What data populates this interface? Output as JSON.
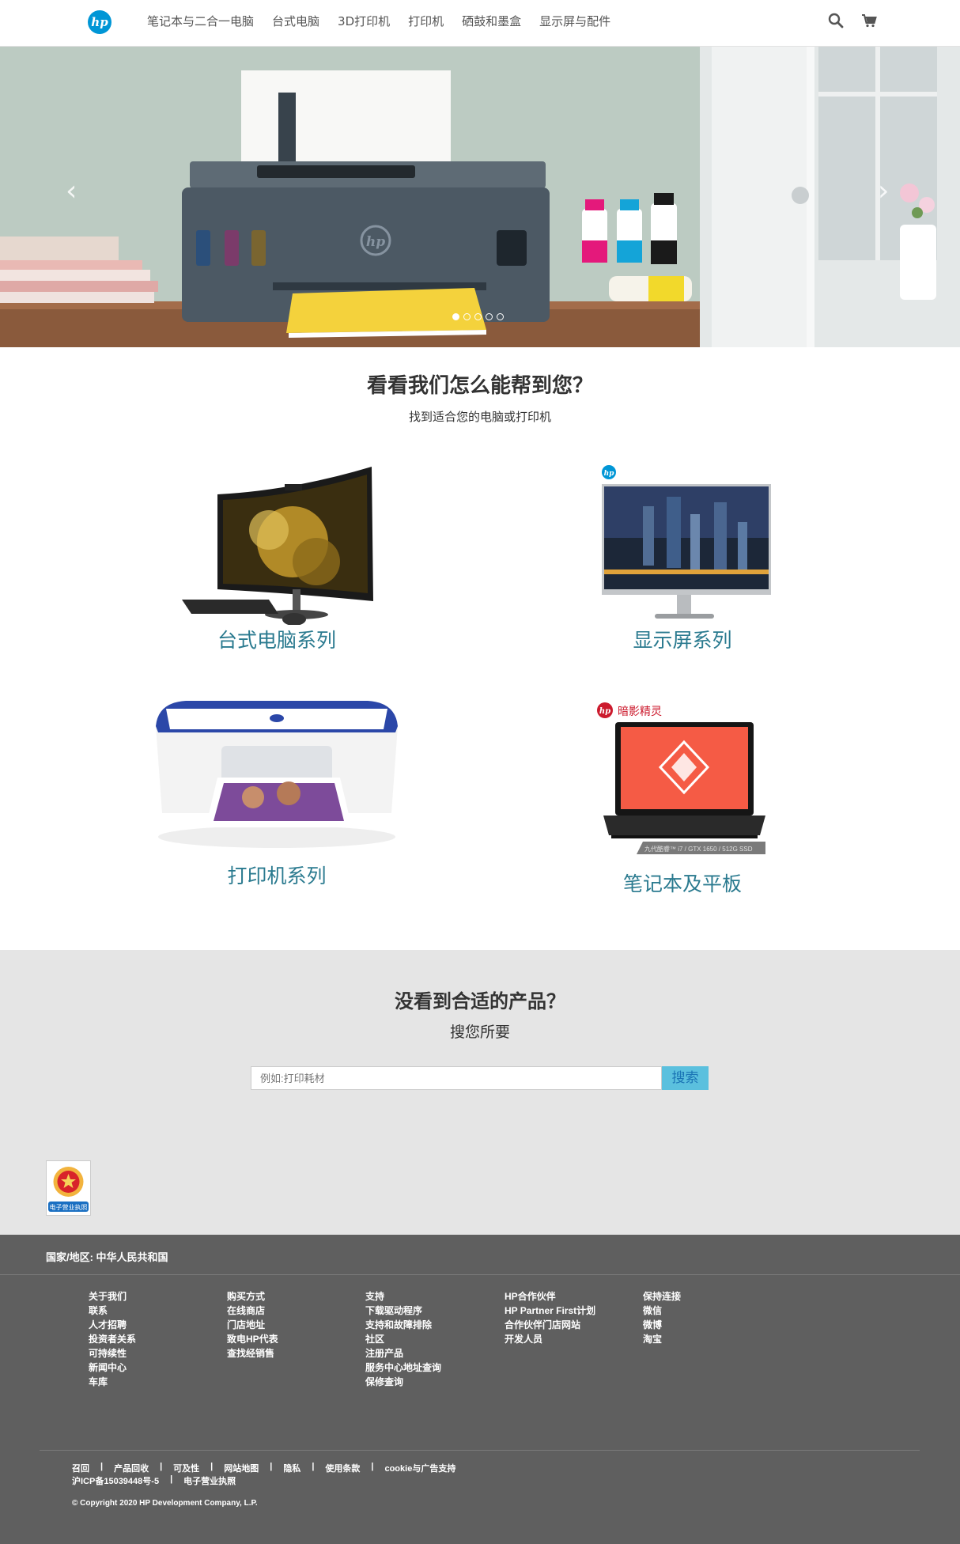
{
  "header": {
    "logo_text": "hp",
    "nav": [
      "笔记本与二合一电脑",
      "台式电脑",
      "3D打印机",
      "打印机",
      "硒鼓和墨盒",
      "显示屏与配件"
    ],
    "icons": [
      "search-icon",
      "cart-icon"
    ]
  },
  "carousel": {
    "slide_count": 5,
    "active_slide": 1,
    "image_text": "hp"
  },
  "help": {
    "title": "看看我们怎么能帮到您？",
    "subtitle": "找到适合您的电脑或打印机",
    "categories": [
      {
        "label": "台式电脑系列",
        "image": "desktop-computer"
      },
      {
        "label": "显示屏系列",
        "image": "monitor",
        "badge": "hp"
      },
      {
        "label": "打印机系列",
        "image": "printer"
      },
      {
        "label": "笔记本及平板",
        "image": "laptop",
        "badge": "暗影精灵",
        "caption": "九代酷睿™ i7 / GTX 1650 / 512G SSD"
      }
    ]
  },
  "search": {
    "title": "没看到合适的产品？",
    "subtitle": "搜您所要",
    "placeholder": "例如:打印耗材",
    "button": "搜索",
    "license_label": "电子营业执照"
  },
  "footer": {
    "region": "国家/地区: 中华人民共和国",
    "columns": [
      [
        "关于我们",
        "联系",
        "人才招聘",
        "投资者关系",
        "可持续性",
        "新闻中心",
        "车库"
      ],
      [
        "购买方式",
        "在线商店",
        "门店地址",
        "致电HP代表",
        "查找经销售"
      ],
      [
        "支持",
        "下载驱动程序",
        "支持和故障排除",
        "社区",
        "注册产品",
        "服务中心地址查询",
        "保修查询"
      ],
      [
        "HP合作伙伴",
        "HP Partner First计划",
        "合作伙伴门店网站",
        "开发人员"
      ],
      [
        "保持连接",
        "微信",
        "微博",
        "淘宝"
      ]
    ],
    "legal": [
      "召回",
      "产品回收",
      "可及性",
      "网站地图",
      "隐私",
      "使用条款",
      "cookie与广告支持"
    ],
    "icp": [
      "沪ICP备15039448号-5",
      "电子营业执照"
    ],
    "copyright": "© Copyright 2020 HP Development Company, L.P."
  }
}
